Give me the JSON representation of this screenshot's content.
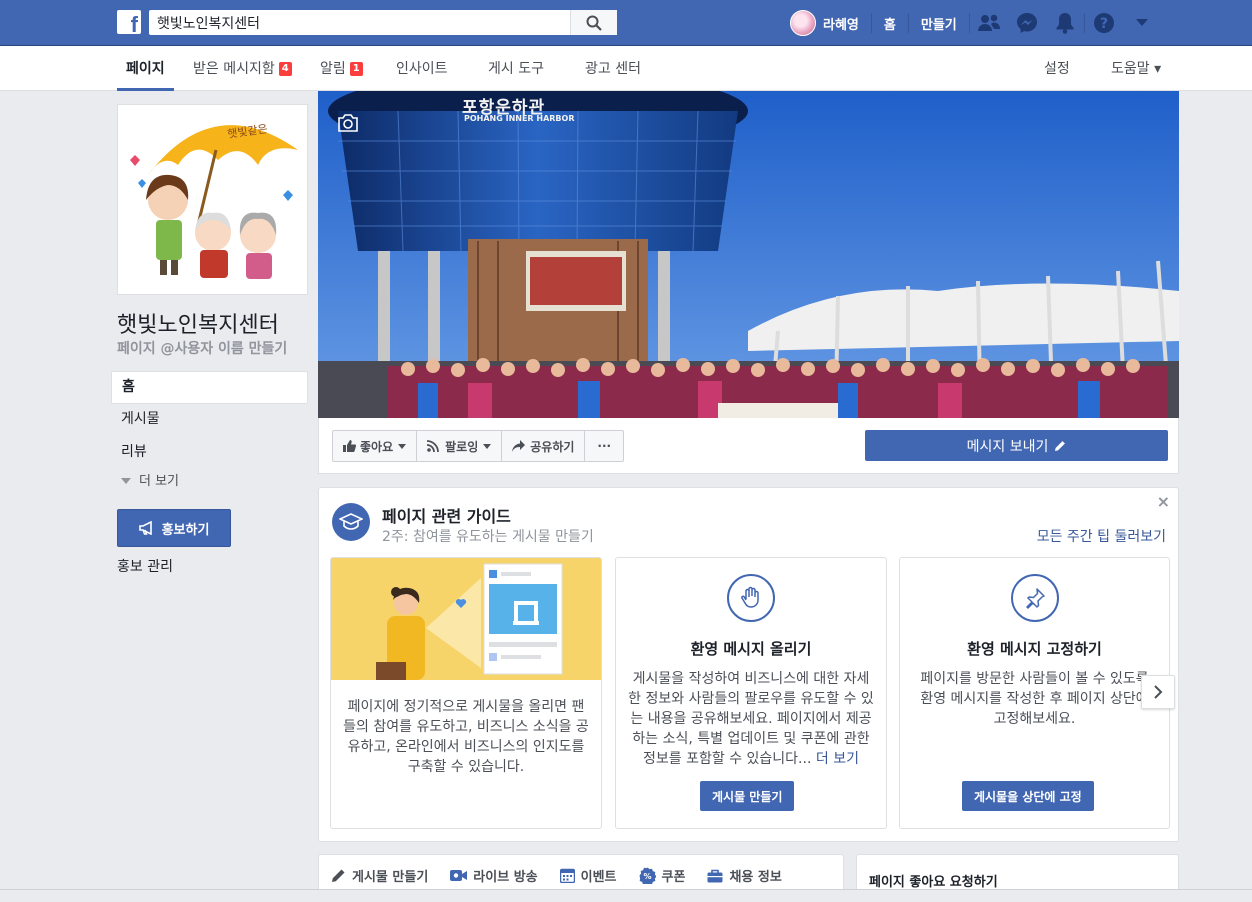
{
  "topbar": {
    "search_value": "햇빛노인복지센터",
    "profile_name": "라혜영",
    "home_label": "홈",
    "create_label": "만들기"
  },
  "pagenav": {
    "page": "페이지",
    "inbox": "받은 메시지함",
    "inbox_count": "4",
    "notifications": "알림",
    "notifications_count": "1",
    "insights": "인사이트",
    "publishing_tools": "게시 도구",
    "ad_center": "광고 센터",
    "settings": "설정",
    "help": "도움말 ▾"
  },
  "page": {
    "name": "햇빛노인복지센터",
    "handle": "페이지 @사용자 이름 만들기"
  },
  "left_nav": {
    "items": [
      "홈",
      "게시물",
      "리뷰"
    ],
    "more": "더 보기",
    "promote": "홍보하기",
    "promote_manage": "홍보 관리"
  },
  "cover": {
    "sign_korean": "포항운하관",
    "sign_english": "POHANG INNER HARBOR"
  },
  "cover_actions": {
    "like": "좋아요",
    "follow": "팔로잉",
    "share": "공유하기",
    "more": "···",
    "send_message": "메시지 보내기"
  },
  "guide": {
    "title": "페이지 관련 가이드",
    "subtitle": "2주: 참여를 유도하는 게시물 만들기",
    "see_all": "모든 주간 팁 둘러보기",
    "close": "×",
    "cards": [
      {
        "text": "페이지에 정기적으로 게시물을 올리면 팬들의 참여를 유도하고, 비즈니스 소식을 공유하고, 온라인에서 비즈니스의 인지도를 구축할 수 있습니다."
      },
      {
        "title": "환영 메시지 올리기",
        "text": "게시물을 작성하여 비즈니스에 대한 자세한 정보와 사람들의 팔로우를 유도할 수 있는 내용을 공유해보세요. 페이지에서 제공하는 소식, 특별 업데이트 및 쿠폰에 관한 정보를 포함할 수 있습니다...",
        "more": "더 보기",
        "button": "게시물 만들기"
      },
      {
        "title": "환영 메시지 고정하기",
        "text": "페이지를 방문한 사람들이 볼 수 있도록 환영 메시지를 작성한 후 페이지 상단에 고정해보세요.",
        "button": "게시물을 상단에 고정"
      }
    ]
  },
  "composer": {
    "items": [
      "게시물 만들기",
      "라이브 방송",
      "이벤트",
      "쿠폰",
      "채용 정보"
    ]
  },
  "likes_request": "페이지 좋아요 요청하기",
  "colors": {
    "brand_blue": "#4267b2",
    "badge_red": "#fa3e3e",
    "background": "#e9ebee"
  },
  "icons": [
    "facebook-logo-icon",
    "search-icon",
    "friends-icon",
    "messenger-icon",
    "bell-icon",
    "help-icon",
    "caret-down-icon",
    "camera-icon",
    "thumbs-up-icon",
    "rss-icon",
    "share-icon",
    "pencil-icon",
    "graduation-cap-icon",
    "wave-hand-icon",
    "pin-icon",
    "chevron-right-icon",
    "megaphone-icon",
    "video-icon",
    "calendar-icon",
    "coupon-icon",
    "briefcase-icon"
  ]
}
